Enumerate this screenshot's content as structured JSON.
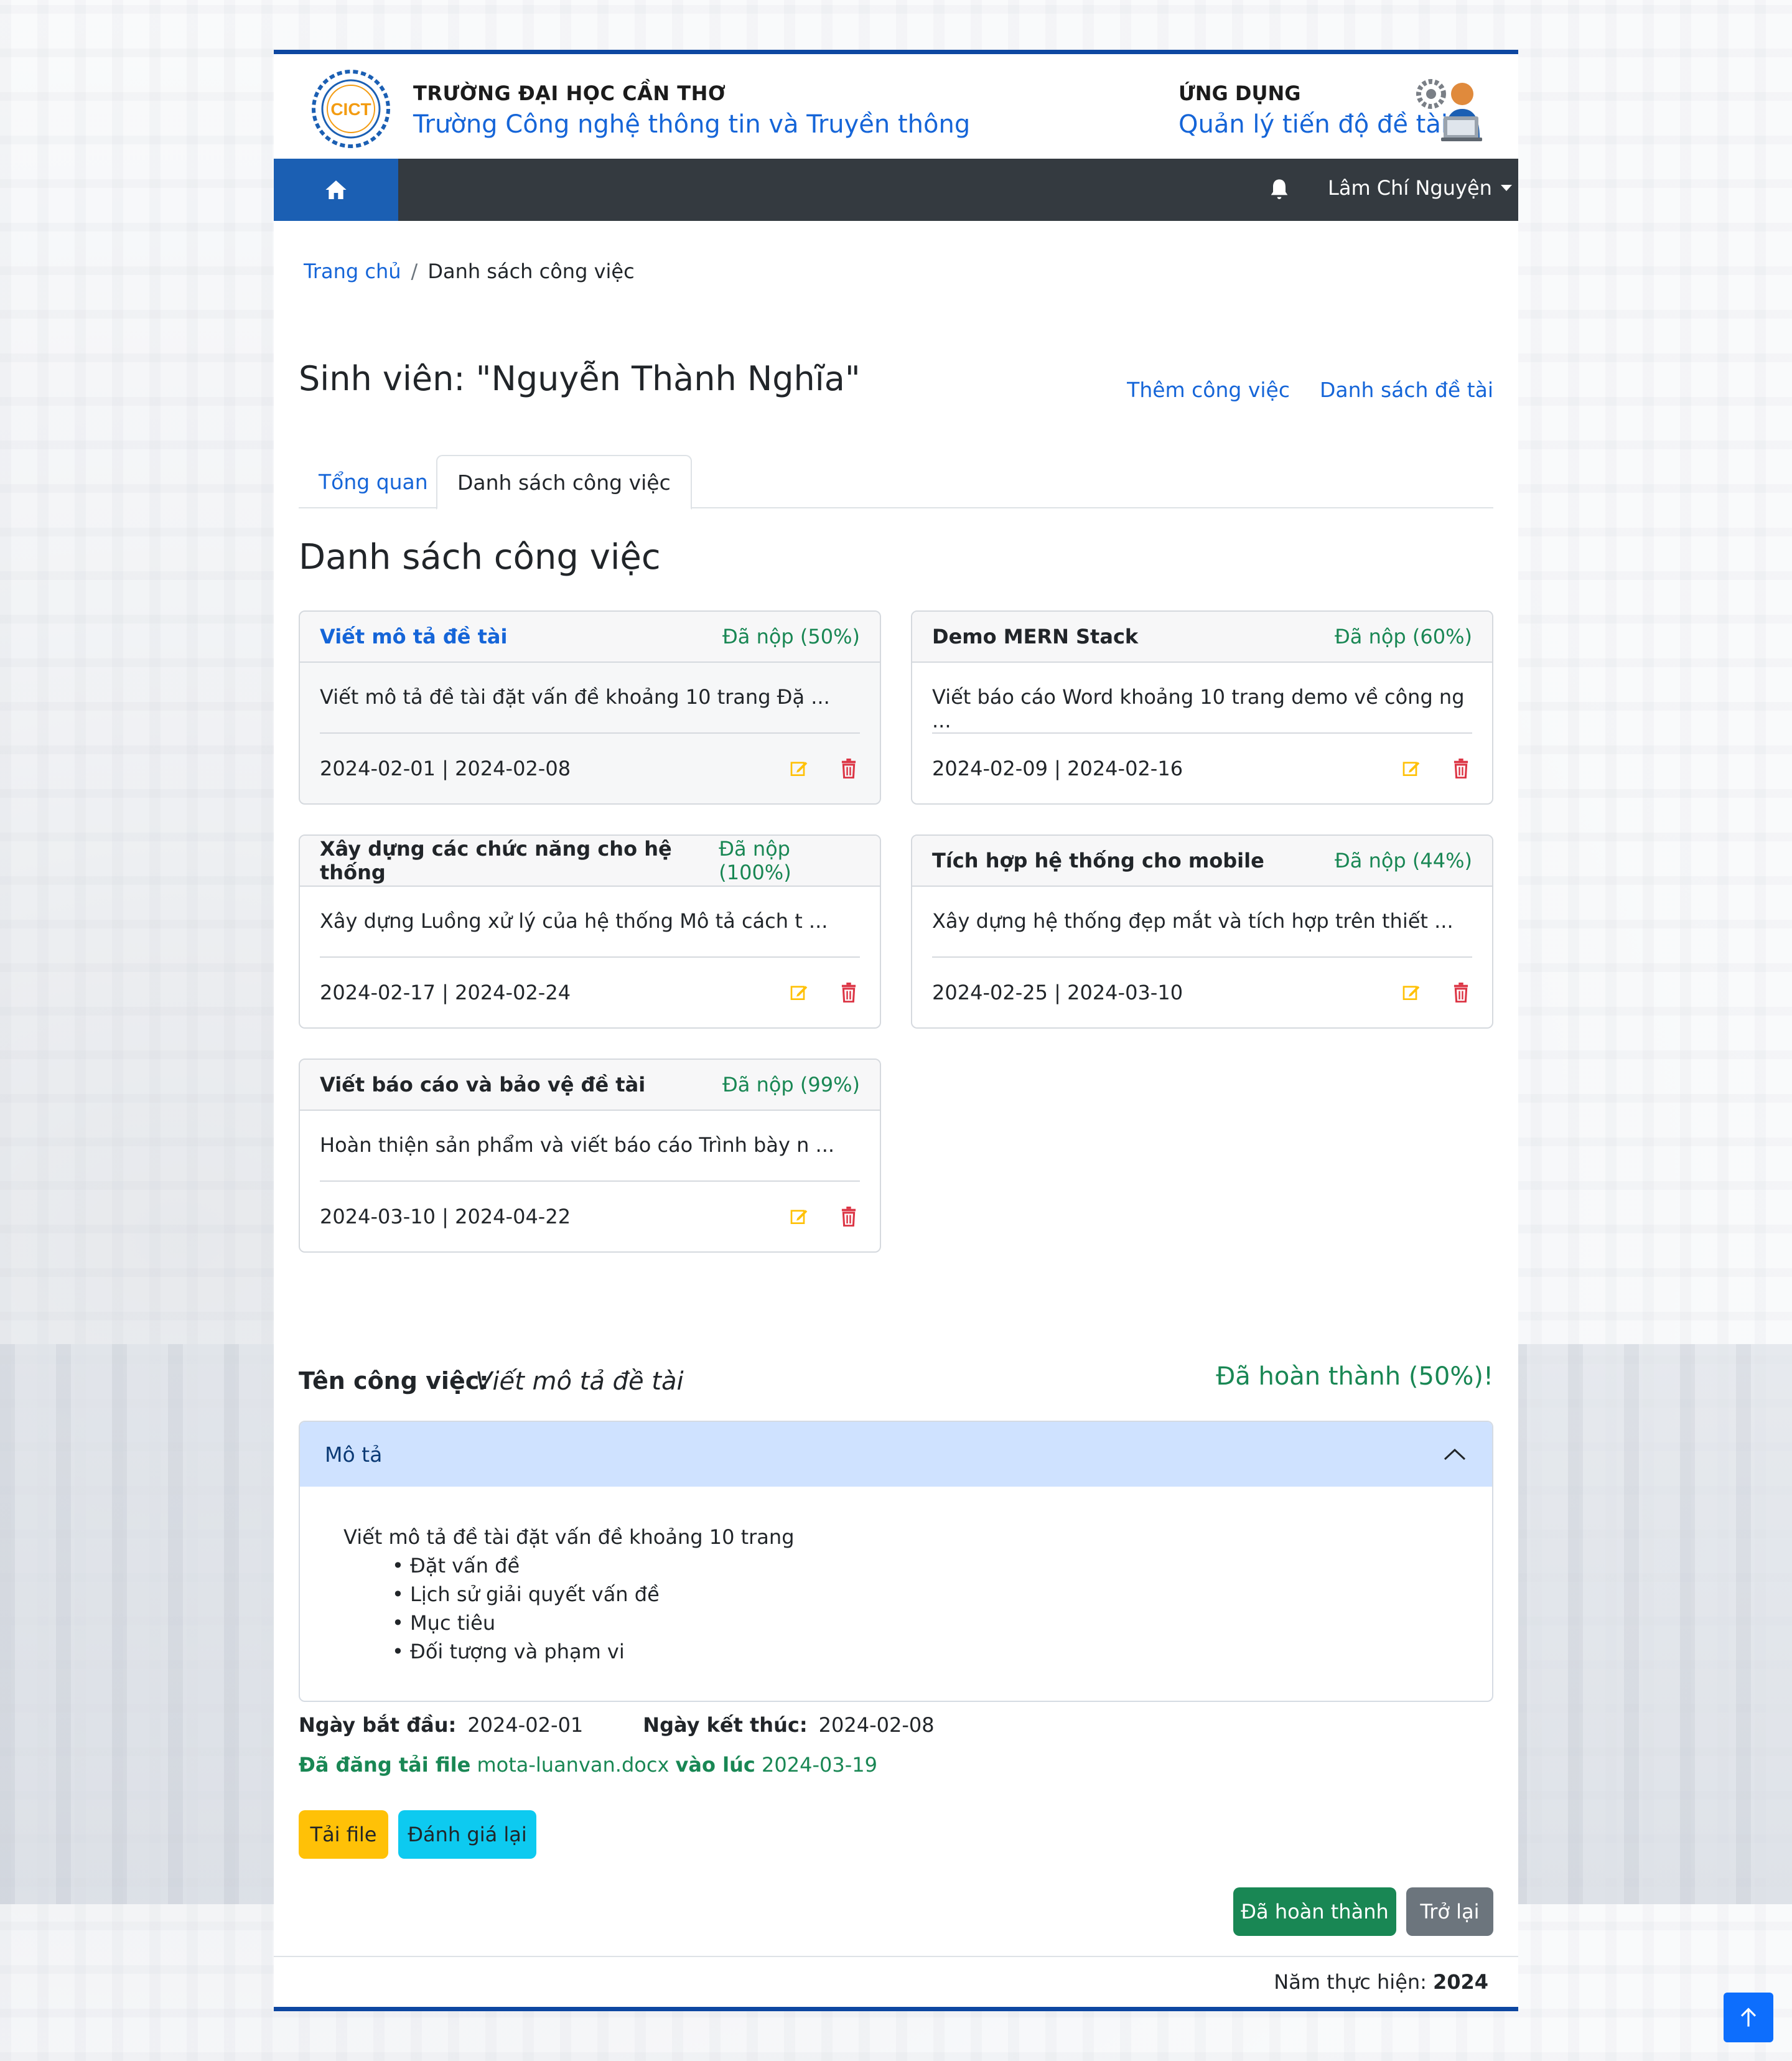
{
  "header": {
    "school_top": "TRƯỜNG ĐẠI HỌC CẦN THƠ",
    "school_bottom": "Trường Công nghệ thông tin và Truyền thông",
    "app_top": "ỨNG DỤNG",
    "app_bottom": "Quản lý tiến độ đề tài",
    "logo_text": "CICT"
  },
  "nav": {
    "home_icon": "home-icon",
    "bell_icon": "bell-icon",
    "user_name": "Lâm Chí Nguyện"
  },
  "breadcrumb": {
    "home": "Trang chủ",
    "separator": "/",
    "current": "Danh sách công việc"
  },
  "page": {
    "student_title": "Sinh viên: \"Nguyễn Thành Nghĩa\"",
    "add_task_link": "Thêm công việc",
    "topic_list_link": "Danh sách đề tài",
    "tabs": [
      {
        "label": "Tổng quan"
      },
      {
        "label": "Danh sách công việc"
      }
    ],
    "section_title": "Danh sách công việc"
  },
  "tasks": [
    {
      "title": "Viết mô tả đề tài",
      "status": "Đã nộp (50%)",
      "desc": "Viết mô tả đề tài đặt vấn đề khoảng 10 trang Đặ ...",
      "dates": "2024-02-01 | 2024-02-08"
    },
    {
      "title": "Demo MERN Stack",
      "status": "Đã nộp (60%)",
      "desc": "Viết báo cáo Word khoảng 10 trang demo về công ng ...",
      "dates": "2024-02-09 | 2024-02-16"
    },
    {
      "title": "Xây dựng các chức năng cho hệ thống",
      "status": "Đã nộp (100%)",
      "desc": "Xây dựng Luồng xử lý của hệ thống Mô tả cách t ...",
      "dates": "2024-02-17 | 2024-02-24"
    },
    {
      "title": "Tích hợp hệ thống cho mobile",
      "status": "Đã nộp (44%)",
      "desc": "Xây dựng hệ thống đẹp mắt và tích hợp trên thiết ...",
      "dates": "2024-02-25 | 2024-03-10"
    },
    {
      "title": "Viết báo cáo và bảo vệ đề tài",
      "status": "Đã nộp (99%)",
      "desc": "Hoàn thiện sản phẩm và viết báo cáo Trình bày n ...",
      "dates": "2024-03-10 | 2024-04-22"
    }
  ],
  "detail": {
    "label": "Tên công việc:",
    "name": "Viết mô tả đề tài",
    "status": "Đã hoàn thành (50%)!",
    "accordion_title": "Mô tả",
    "description_intro": "Viết mô tả đề tài đặt vấn đề khoảng 10 trang",
    "description_items": [
      "Đặt vấn đề",
      "Lịch sử giải quyết vấn đề",
      "Mục tiêu",
      "Đối tượng và phạm vi"
    ],
    "start_label": "Ngày bắt đầu:",
    "start_value": "2024-02-01",
    "end_label": "Ngày kết thúc:",
    "end_value": "2024-02-08",
    "upload_prefix": "Đã đăng tải file",
    "upload_file": "mota-luanvan.docx",
    "upload_mid": "vào lúc",
    "upload_date": "2024-03-19"
  },
  "buttons": {
    "download": "Tải file",
    "reevaluate": "Đánh giá lại",
    "complete": "Đã hoàn thành",
    "back": "Trở lại"
  },
  "footer": {
    "label": "Năm thực hiện:",
    "year": "2024"
  },
  "colors": {
    "primary": "#1565d8",
    "success": "#198754",
    "warning": "#ffc107",
    "danger": "#dc3545",
    "info": "#0dcaf0",
    "nav_dark": "#343a40",
    "border_blue": "#0d47a1"
  }
}
